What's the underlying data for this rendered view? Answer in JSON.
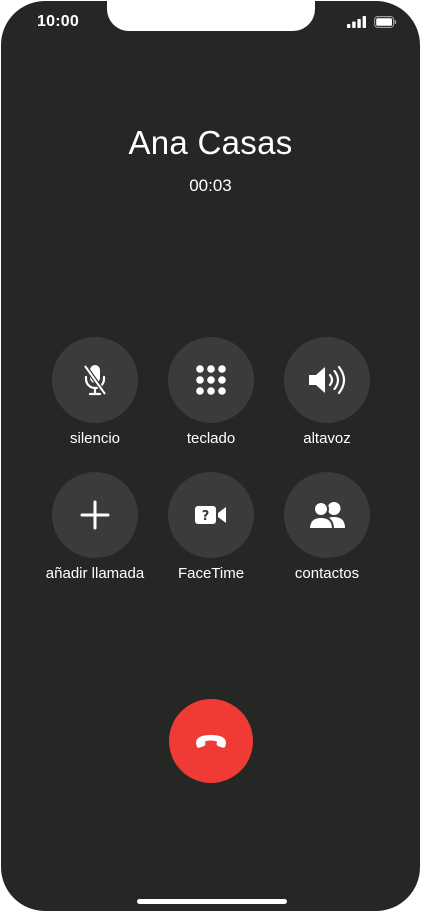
{
  "status_bar": {
    "time": "10:00",
    "signal_icon": "signal-bars-icon",
    "battery_icon": "battery-icon"
  },
  "call": {
    "caller_name": "Ana Casas",
    "duration": "00:03"
  },
  "controls": [
    {
      "label": "silencio",
      "icon": "microphone-muted-icon"
    },
    {
      "label": "teclado",
      "icon": "keypad-icon"
    },
    {
      "label": "altavoz",
      "icon": "speaker-icon"
    },
    {
      "label": "añadir llamada",
      "icon": "plus-icon"
    },
    {
      "label": "FaceTime",
      "icon": "facetime-video-icon"
    },
    {
      "label": "contactos",
      "icon": "contacts-icon"
    }
  ],
  "end_call": {
    "icon": "end-call-phone-icon"
  },
  "colors": {
    "background": "#252725",
    "control_button": "#393c39",
    "end_call": "#f03a35",
    "text": "#ffffff"
  }
}
